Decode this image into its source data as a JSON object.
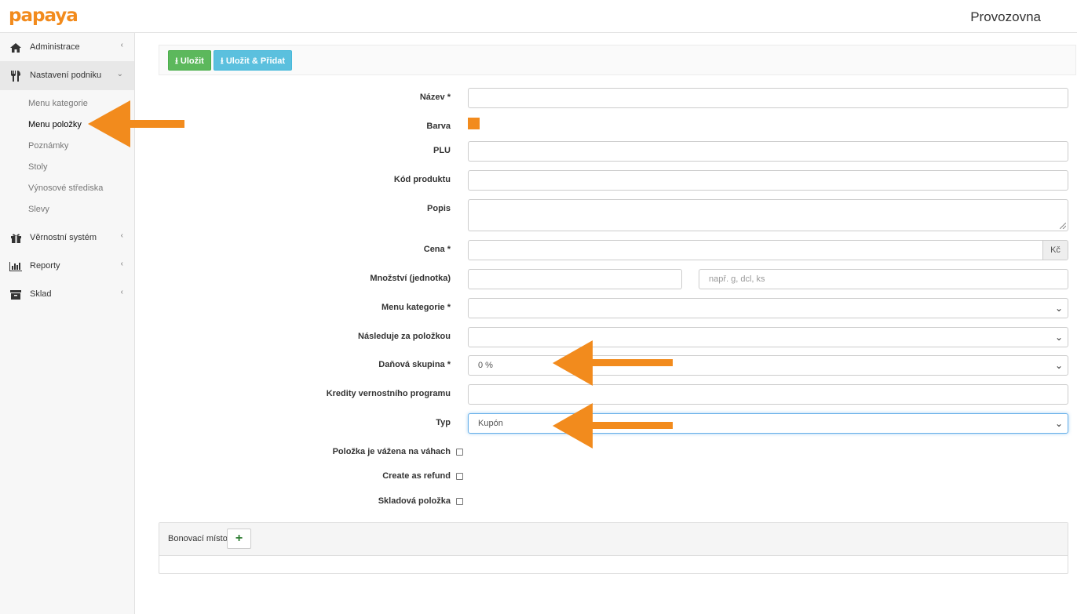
{
  "app": {
    "logo": "papaya",
    "page_title": "Provozovna"
  },
  "sidebar": {
    "items": [
      {
        "label": "Administrace",
        "icon": "home-icon"
      },
      {
        "label": "Nastavení podniku",
        "icon": "cutlery-icon"
      },
      {
        "label": "Věrnostní systém",
        "icon": "gift-icon"
      },
      {
        "label": "Reporty",
        "icon": "bar-chart-icon"
      },
      {
        "label": "Sklad",
        "icon": "archive-icon"
      }
    ],
    "submenu": [
      "Menu kategorie",
      "Menu položky",
      "Poznámky",
      "Stoly",
      "Výnosové střediska",
      "Slevy"
    ]
  },
  "toolbar": {
    "save_label": "Uložit",
    "save_add_label": "Uložit & Přidat"
  },
  "form": {
    "name_label": "Název *",
    "color_label": "Barva",
    "color_value": "#f28b1d",
    "plu_label": "PLU",
    "product_code_label": "Kód produktu",
    "description_label": "Popis",
    "price_label": "Cena *",
    "price_currency": "Kč",
    "quantity_label": "Množství (jednotka)",
    "unit_placeholder": "např. g, dcl, ks",
    "menu_category_label": "Menu kategorie *",
    "follows_item_label": "Následuje za položkou",
    "tax_group_label": "Daňová skupina *",
    "tax_group_value": "0 %",
    "loyalty_credits_label": "Kredity vernostního programu",
    "type_label": "Typ",
    "type_value": "Kupón",
    "weighed_label": "Položka je vážena na váhach",
    "refund_label": "Create as refund",
    "stock_item_label": "Skladová položka"
  },
  "panel": {
    "title": "Bonovací místo"
  },
  "annotation_color": "#f28b1d"
}
